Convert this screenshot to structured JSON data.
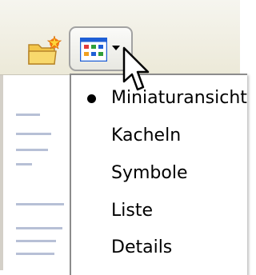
{
  "toolbar": {
    "folder_icon": "new-folder-icon",
    "view_button_icon": "views-grid-icon",
    "view_button_arrow": "dropdown-arrow-icon"
  },
  "view_menu": {
    "items": [
      {
        "label": "Miniaturansicht",
        "selected": true
      },
      {
        "label": "Kacheln",
        "selected": false
      },
      {
        "label": "Symbole",
        "selected": false
      },
      {
        "label": "Liste",
        "selected": false
      },
      {
        "label": "Details",
        "selected": false
      }
    ]
  },
  "colors": {
    "toolbar_bg": "#ece9d8",
    "menu_bg": "#ffffff",
    "grid_blue": "#1f5fd6",
    "folder_yellow": "#f3c64a"
  }
}
